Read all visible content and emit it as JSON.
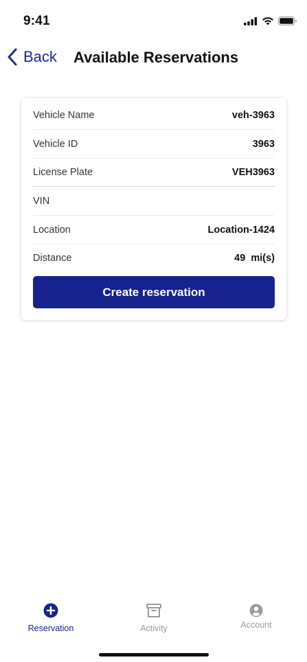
{
  "status_bar": {
    "time": "9:41"
  },
  "nav": {
    "back_label": "Back",
    "title": "Available Reservations"
  },
  "vehicle": {
    "rows": [
      {
        "label": "Vehicle Name",
        "value": "veh-3963"
      },
      {
        "label": "Vehicle ID",
        "value": "3963"
      },
      {
        "label": "License Plate",
        "value": "VEH3963"
      },
      {
        "label": "VIN",
        "value": ""
      },
      {
        "label": "Location",
        "value": "Location-1424"
      },
      {
        "label": "Distance",
        "value": "49  mi(s)"
      }
    ],
    "button_label": "Create reservation"
  },
  "tabs": [
    {
      "label": "Reservation",
      "icon": "plus-circle-icon",
      "active": true
    },
    {
      "label": "Activity",
      "icon": "archive-box-icon",
      "active": false
    },
    {
      "label": "Account",
      "icon": "user-circle-icon",
      "active": false
    }
  ],
  "colors": {
    "accent": "#16238f",
    "inactive": "#9a9a9a"
  }
}
